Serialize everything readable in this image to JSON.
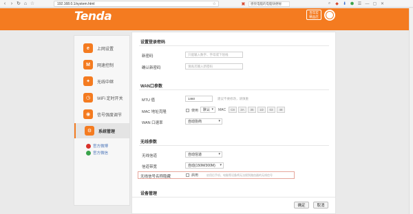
{
  "browser": {
    "url": "192.168.0.1/system.html",
    "search_text": "感觉电脑的电脑快便秘 ",
    "nav_back": "‹",
    "nav_forward": "›",
    "nav_reload": "↻",
    "nav_home": "⌂"
  },
  "header": {
    "logo": "Tenda",
    "badge_line1": "百年宏",
    "badge_line2": "精品店"
  },
  "sidebar": {
    "items": [
      {
        "label": "上网设置",
        "icon": "e"
      },
      {
        "label": "网速控制",
        "icon": "M"
      },
      {
        "label": "无线中继",
        "icon": "✦"
      },
      {
        "label": "WiFi 定时开关",
        "icon": "◷"
      },
      {
        "label": "信号强度调节",
        "icon": "◉"
      },
      {
        "label": "系统管理",
        "icon": "⚙"
      }
    ],
    "social": [
      {
        "label": "官方微博",
        "color": "#d8322b"
      },
      {
        "label": "官方微信",
        "color": "#3aa34b"
      }
    ]
  },
  "password_section": {
    "title": "设置登录密码",
    "new_label": "新密码",
    "new_placeholder": "只能输入数字、字母或下划线",
    "confirm_label": "确认新密码",
    "confirm_placeholder": "请再次输入新密码"
  },
  "wan_section": {
    "title": "WAN口参数",
    "mtu_label": "MTU 值",
    "mtu_value": "1460",
    "mtu_hint": "建议不要修改，请慎重",
    "mac_label": "MAC 地址克隆",
    "mac_use": "使用",
    "mac_mode": "默认",
    "mac_prefix": "MAC",
    "mac_parts": [
      "C8",
      "3A",
      "35",
      "1D",
      "03",
      "48"
    ],
    "speed_label": "WAN 口速率",
    "speed_value": "自动协商"
  },
  "wireless_section": {
    "title": "无线参数",
    "channel_label": "无线信道",
    "channel_value": "自动信道",
    "bandwidth_label": "信道带宽",
    "bandwidth_value": "自动(150M/300M)",
    "hide_label": "无线信号名称隐藏",
    "hide_enable": "启用",
    "hide_hint": "启用后手机、电脑等设备将无法搜到路由器的无线信号"
  },
  "device_section": {
    "title": "设备管理"
  },
  "footer": {
    "ok": "确定",
    "cancel": "取消"
  }
}
